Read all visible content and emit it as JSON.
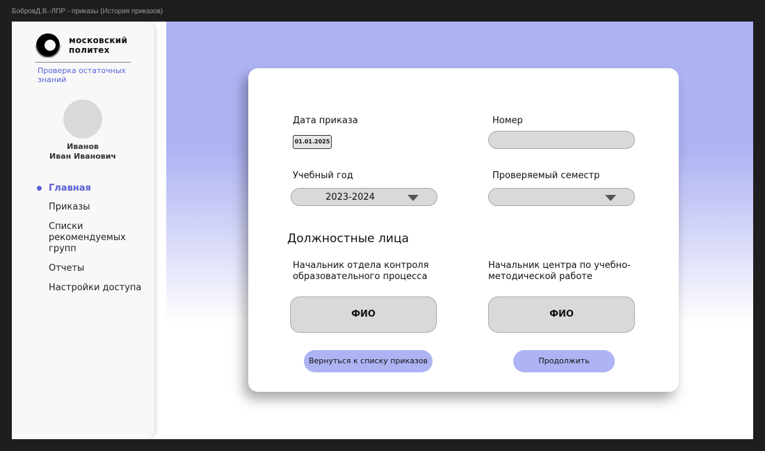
{
  "window": {
    "title": "БобровД.В.-ЛПР - приказы (История приказов)"
  },
  "sidebar": {
    "logo_text": "московский\nполитех",
    "subtitle": "Проверка остаточных знаний",
    "user_name": "Иванов\nИван Иванович",
    "items": [
      {
        "label": "Главная",
        "active": true
      },
      {
        "label": "Приказы"
      },
      {
        "label": "Списки рекомендуемых групп"
      },
      {
        "label": "Отчеты"
      },
      {
        "label": "Настройки доступа"
      }
    ]
  },
  "form": {
    "date_label": "Дата приказа",
    "date_value": "01.01.2025",
    "number_label": "Номер",
    "number_value": "",
    "year_label": "Учебный год",
    "year_value": "2023-2024",
    "semester_label": "Проверяемый семестр",
    "semester_value": "",
    "officials_title": "Должностные лица",
    "official1_label": "Начальник отдела контроля образовательного процесса",
    "official1_value": "ФИО",
    "official2_label": "Начальник центра по учебно-методической работе",
    "official2_value": "ФИО",
    "back_button": "Вернуться к списку приказов",
    "continue_button": "Продолжить"
  },
  "colors": {
    "accent": "#5a5fd6",
    "button": "#aeb3f3",
    "field": "#d9d9d9"
  }
}
